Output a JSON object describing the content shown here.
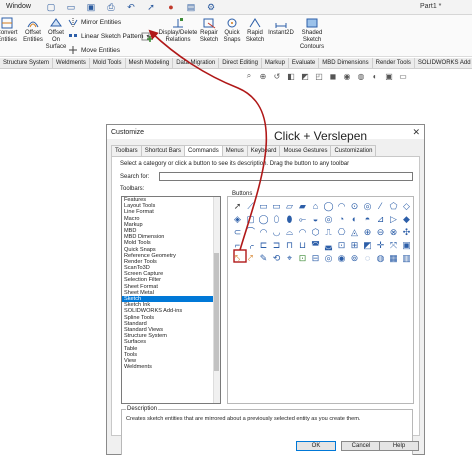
{
  "menubar": {
    "window_label": "Window",
    "part_name": "Part1 *",
    "quick_access": [
      "new-icon",
      "open-icon",
      "save-icon",
      "print-icon",
      "undo-icon",
      "select-icon",
      "rebuild-icon",
      "file-properties-icon",
      "options-icon"
    ]
  },
  "ribbon": {
    "convert": "Convert\nEntities",
    "offset": "Offset\nEntities",
    "offset_surface": "Offset\nOn\nSurface",
    "mirror": "Mirror Entities",
    "linear_pattern": "Linear Sketch Pattern",
    "move": "Move Entities",
    "display_delete": "Display/Delete\nRelations",
    "repair": "Repair\nSketch",
    "quick_snaps": "Quick\nSnaps",
    "rapid_sketch": "Rapid\nSketch",
    "instant2d": "Instant2D",
    "shaded_contours": "Shaded\nSketch\nContours"
  },
  "command_tabs": [
    "Structure System",
    "Weldments",
    "Mold Tools",
    "Mesh Modeling",
    "Data Migration",
    "Direct Editing",
    "Markup",
    "Evaluate",
    "MBD Dimensions",
    "Render Tools",
    "SOLIDWORKS Add"
  ],
  "dialog": {
    "title": "Customize",
    "caption": "Click + Verslepen",
    "tabs": [
      "Toolbars",
      "Shortcut Bars",
      "Commands",
      "Menus",
      "Keyboard",
      "Mouse Gestures",
      "Customization"
    ],
    "active_tab": "Commands",
    "instruction": "Select a category or click a button to see its description. Drag the button to any toolbar",
    "search_label": "Search for:",
    "search_value": "",
    "toolbars_label": "Toolbars:",
    "toolbars": [
      "Features",
      "Layout Tools",
      "Line Format",
      "Macro",
      "Markup",
      "MBD",
      "MBD Dimension",
      "Mold Tools",
      "Quick Snaps",
      "Reference Geometry",
      "Render Tools",
      "ScanTo3D",
      "Screen Capture",
      "Selection Filter",
      "Sheet Format",
      "Sheet Metal",
      "Sketch",
      "Sketch Ink",
      "SOLIDWORKS Add-ins",
      "Spline Tools",
      "Standard",
      "Standard Views",
      "Structure System",
      "Surfaces",
      "Table",
      "Tools",
      "View",
      "Weldments"
    ],
    "selected_toolbar": "Sketch",
    "buttons_label": "Buttons",
    "description_label": "Description",
    "description_text": "Creates sketch entities that are mirrored about a previously selected entity as you create them.",
    "ok": "OK",
    "cancel": "Cancel",
    "help": "Help"
  }
}
